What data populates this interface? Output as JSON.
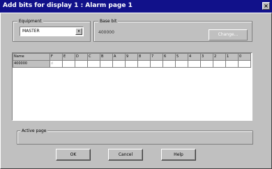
{
  "window": {
    "title": "Add bits for display 1 : Alarm page 1",
    "close_label": "×"
  },
  "equipment": {
    "legend": "Equipment",
    "value": "MASTER",
    "arrow": "▾"
  },
  "base_bit": {
    "legend": "Base bit",
    "value": "400000",
    "button_label": "Change..."
  },
  "grid": {
    "columns": [
      "Name",
      "F",
      "E",
      "D",
      "C",
      "B",
      "A",
      "9",
      "8",
      "7",
      "6",
      "5",
      "4",
      "3",
      "2",
      "1",
      "0"
    ],
    "rows": [
      {
        "name": "400000",
        "cursor_icon": "☝"
      }
    ]
  },
  "active_page": {
    "legend": "Active page"
  },
  "buttons": {
    "ok": "OK",
    "cancel": "Cancel",
    "help": "Help"
  }
}
